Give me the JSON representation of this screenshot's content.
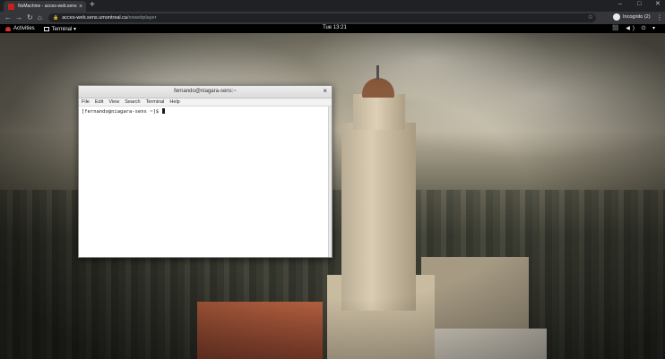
{
  "browser": {
    "tab": {
      "title": "NoMachine - acces-web.sens.umontreal.ca"
    },
    "new_tab": "+",
    "window_controls": [
      "–",
      "□",
      "✕"
    ],
    "nav": {
      "back": "←",
      "forward": "→",
      "reload": "↻",
      "home": "⌂"
    },
    "url_host": "acces-web.sens.umontreal.ca",
    "url_path": "/nxwebplayer",
    "profile_label": "Incognito (2)",
    "menu": "⋮"
  },
  "gnome": {
    "activities": "Activities",
    "app_menu": "Terminal ▾",
    "clock": "Tue 13:21",
    "tray": "⬛ ◀) ⏻ ▾"
  },
  "terminal": {
    "title": "fernando@niagara-sens:~",
    "close": "×",
    "menus": [
      "File",
      "Edit",
      "View",
      "Search",
      "Terminal",
      "Help"
    ],
    "prompt": "[fernando@niagara-sens ~]$ "
  },
  "colors": {
    "chrome_dark": "#202124",
    "chrome_toolbar": "#35363a",
    "gnome_bar": "#000000",
    "terminal_bg": "#ffffff"
  }
}
